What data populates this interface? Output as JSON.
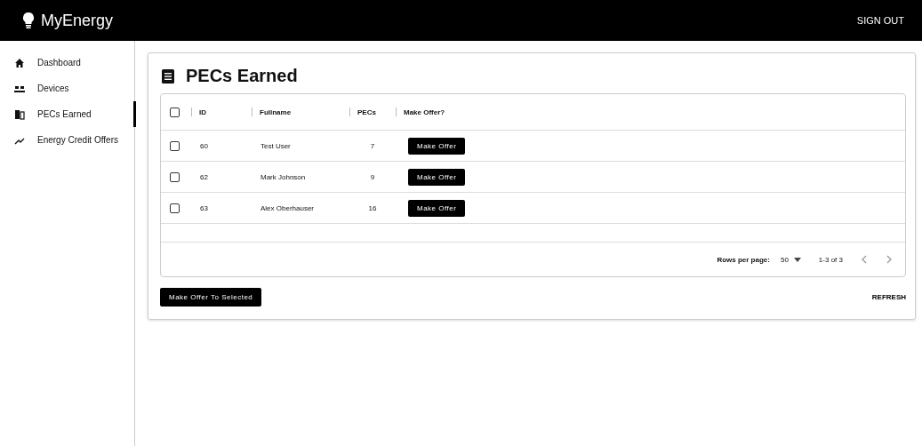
{
  "app_bar": {
    "title": "MyEnergy",
    "action": "SIGN OUT"
  },
  "sidebar": {
    "items": [
      {
        "label": "Dashboard",
        "selected": false
      },
      {
        "label": "Devices",
        "selected": false
      },
      {
        "label": "PECs Earned",
        "selected": true
      },
      {
        "label": "Energy Credit Offers",
        "selected": false
      }
    ]
  },
  "page": {
    "title": "PECs Earned"
  },
  "table": {
    "columns": [
      "ID",
      "Fullname",
      "PECs",
      "Make Offer?"
    ],
    "header_checked": false,
    "rows": [
      {
        "id": "60",
        "fullname": "Test User",
        "pecs": "7",
        "action": "Make Offer",
        "checked": false
      },
      {
        "id": "62",
        "fullname": "Mark Johnson",
        "pecs": "9",
        "action": "Make Offer",
        "checked": false
      },
      {
        "id": "63",
        "fullname": "Alex Oberhauser",
        "pecs": "16",
        "action": "Make Offer",
        "checked": false
      }
    ],
    "footer": {
      "rows_per_page_label": "Rows per page:",
      "rows_per_page": "50",
      "range": "1-3 of 3"
    }
  },
  "buttons": {
    "offer_selected": "Make Offer To Selected",
    "refresh": "REFRESH"
  }
}
